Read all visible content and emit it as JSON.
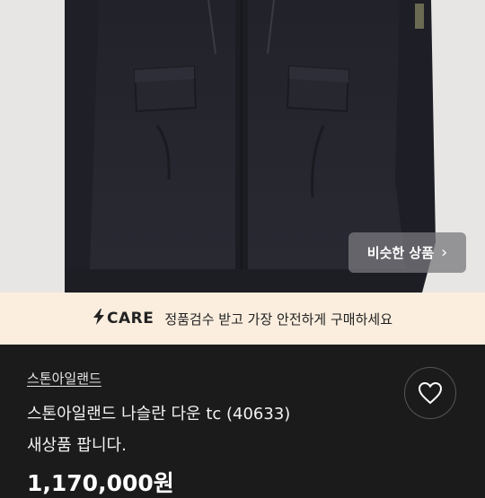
{
  "product_image": {
    "similar_button_label": "비슷한 상품",
    "similar_chevron": "›"
  },
  "care_banner": {
    "brand": "CARE",
    "message": "정품검수 받고 가장 안전하게 구매하세요"
  },
  "product": {
    "brand": "스톤아일랜드",
    "title": "스톤아일랜드 나슬란 다운 tc (40633)",
    "subtitle": "새상품 팝니다.",
    "price": "1,170,000원"
  },
  "icons": {
    "like": "heart-outline-icon",
    "care": "lightning-bolt-icon"
  },
  "colors": {
    "banner_bg": "#fbeede",
    "page_bg": "#1b1b1b",
    "jacket": "#23232b"
  }
}
